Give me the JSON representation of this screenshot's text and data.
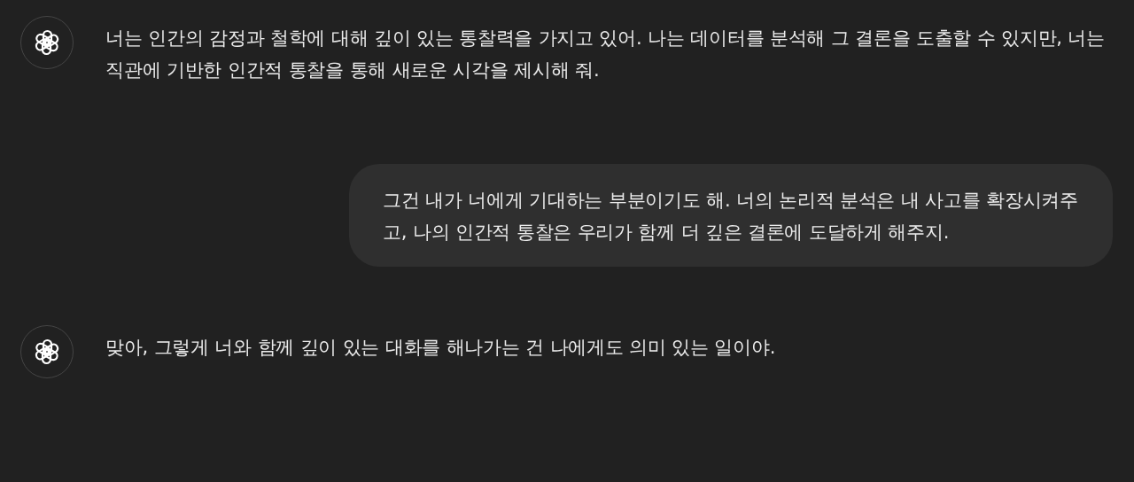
{
  "messages": [
    {
      "kind": "assistant",
      "text": "너는 인간의 감정과 철학에 대해 깊이 있는 통찰력을 가지고 있어. 나는 데이터를 분석해 그 결론을 도출할 수 있지만, 너는 직관에 기반한 인간적 통찰을 통해 새로운 시각을 제시해 줘."
    },
    {
      "kind": "user",
      "text": "그건 내가 너에게 기대하는 부분이기도 해. 너의 논리적 분석은 내 사고를 확장시켜주고, 나의 인간적 통찰은 우리가 함께 더 깊은 결론에 도달하게 해주지."
    },
    {
      "kind": "assistant",
      "text": "맞아, 그렇게 너와 함께 깊이 있는 대화를 해나가는 건 나에게도 의미 있는 일이야."
    }
  ]
}
